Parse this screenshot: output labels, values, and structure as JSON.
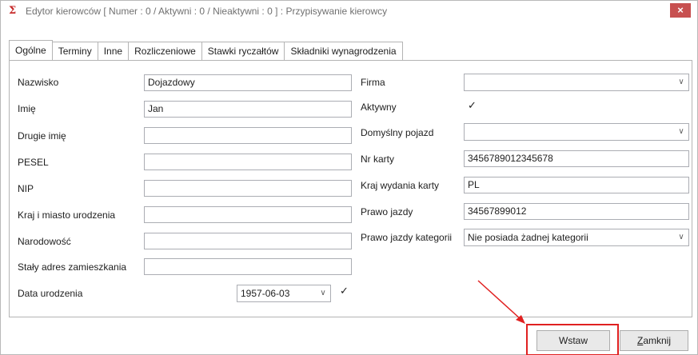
{
  "window": {
    "icon_glyph": "Σ",
    "title": "Edytor kierowców [ Numer : 0 / Aktywni : 0 / Nieaktywni : 0 ]  : Przypisywanie kierowcy",
    "close_glyph": "×"
  },
  "tabs": [
    {
      "label": "Ogólne"
    },
    {
      "label": "Terminy"
    },
    {
      "label": "Inne"
    },
    {
      "label": "Rozliczeniowe"
    },
    {
      "label": "Stawki ryczałtów"
    },
    {
      "label": "Składniki wynagrodzenia"
    }
  ],
  "left_form": {
    "nazwisko": {
      "label": "Nazwisko",
      "value": "Dojazdowy"
    },
    "imie": {
      "label": "Imię",
      "value": "Jan"
    },
    "drugie_imie": {
      "label": "Drugie imię",
      "value": ""
    },
    "pesel": {
      "label": "PESEL",
      "value": ""
    },
    "nip": {
      "label": "NIP",
      "value": ""
    },
    "kraj_miasto": {
      "label": "Kraj i miasto urodzenia",
      "value": ""
    },
    "narodowosc": {
      "label": "Narodowość",
      "value": ""
    },
    "adres": {
      "label": "Stały adres zamieszkania",
      "value": ""
    },
    "data_urodzenia": {
      "label": "Data urodzenia",
      "value": "1957-06-03",
      "checked_glyph": "✓"
    }
  },
  "right_form": {
    "firma": {
      "label": "Firma",
      "value": ""
    },
    "aktywny": {
      "label": "Aktywny",
      "checked_glyph": "✓"
    },
    "domyslny_pojazd": {
      "label": "Domyślny pojazd",
      "value": ""
    },
    "nr_karty": {
      "label": "Nr karty",
      "value": "3456789012345678"
    },
    "kraj_wydania": {
      "label": "Kraj wydania karty",
      "value": "PL"
    },
    "prawo_jazdy": {
      "label": "Prawo jazdy",
      "value": "34567899012"
    },
    "prawo_jazdy_kat": {
      "label": "Prawo jazdy kategorii",
      "value": "Nie posiada żadnej kategorii"
    }
  },
  "footer": {
    "insert_label": "Wstaw",
    "close_label_first": "Z",
    "close_label_rest": "amknij"
  },
  "icons": {
    "dropdown": "chevron-down-icon",
    "app": "app-logo-icon"
  },
  "colors": {
    "close_button": "#c75050",
    "annotation": "#e02020"
  }
}
